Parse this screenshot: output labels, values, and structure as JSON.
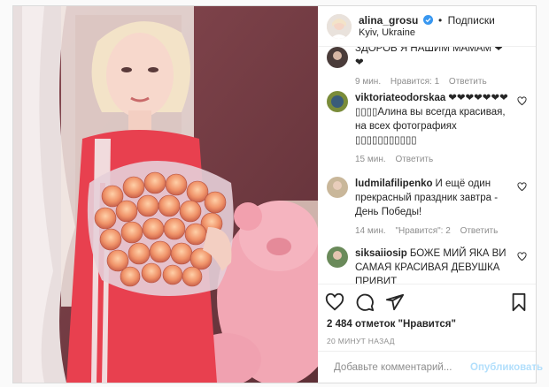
{
  "header": {
    "username": "alina_grosu",
    "follow_label": "Подписки",
    "location": "Kyiv, Ukraine"
  },
  "comments": [
    {
      "text": "ЗДОРОВ Я НАШИМ МАМАМ ❤❤",
      "time": "9 мин.",
      "likes": "Нравится: 1",
      "reply": "Ответить"
    },
    {
      "username": "viktoriateodorskaa",
      "text": "❤❤❤❤❤❤❤▯▯▯▯Алина вы всегда красивая, на всех фотографиях ▯▯▯▯▯▯▯▯▯▯▯",
      "time": "15 мин.",
      "reply": "Ответить"
    },
    {
      "username": "ludmilafilipenko",
      "text": "И ещё один прекрасный праздник завтра - День Победы!",
      "time": "14 мин.",
      "likes": "\"Нравится\": 2",
      "reply": "Ответить"
    },
    {
      "username": "siksaiiosip",
      "text": "БОЖЕ МИЙ ЯКА ВИ САМАЯ КРАСИВАЯ ДЕВУШКА ПРИВИТ"
    }
  ],
  "likes_text": "2 484 отметок \"Нравится\"",
  "time_ago": "20 минут назад",
  "comment_box": {
    "placeholder": "Добавьте комментарий...",
    "publish_label": "Опубликовать"
  },
  "colors": {
    "accent_blue": "#0095f6",
    "publish_disabled": "#b2dffc",
    "muted_text": "#8e8e8e"
  },
  "icons": [
    "verified-badge-icon",
    "heart-icon",
    "comment-icon",
    "share-icon",
    "bookmark-icon",
    "smile-icon"
  ]
}
